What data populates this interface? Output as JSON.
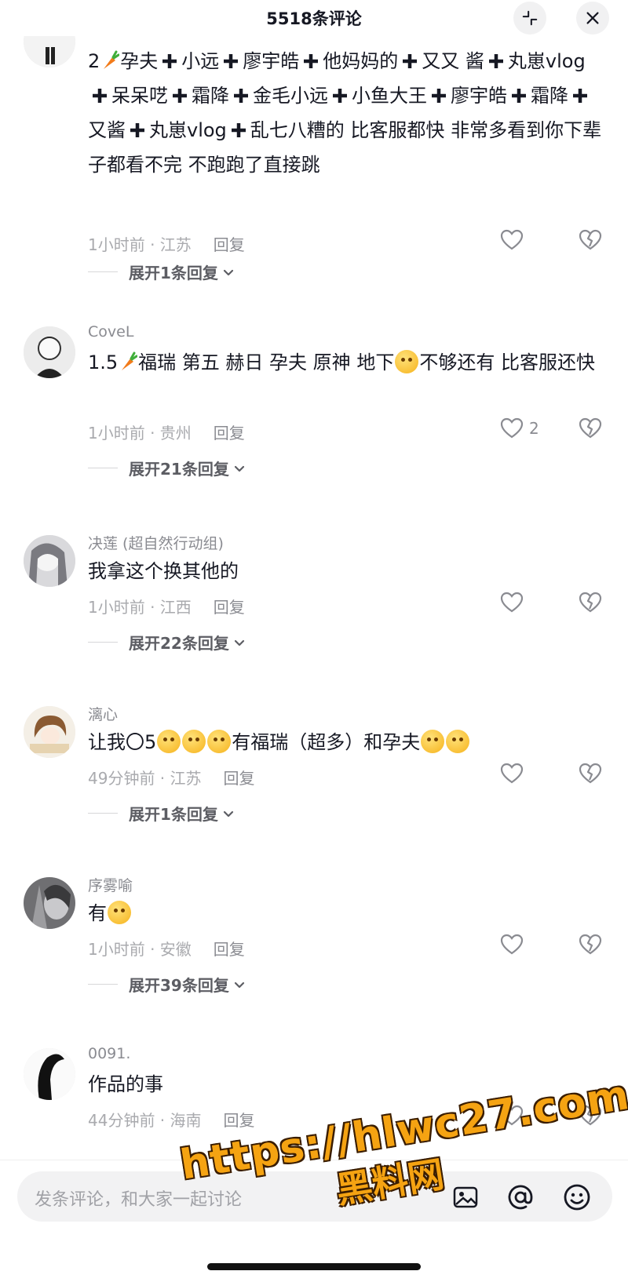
{
  "header": {
    "title": "5518条评论"
  },
  "comments": [
    {
      "username": "",
      "segments": [
        "2",
        "孕夫",
        "小远",
        "廖宇皓",
        "他妈妈的",
        "又又 酱",
        "丸崽vlog",
        "呆呆呓",
        "霜降",
        "金毛小远",
        "小鱼大王",
        "廖宇皓",
        "霜降",
        "又酱",
        "丸崽vlog",
        "乱七八糟的"
      ],
      "tail": "比客服都快 非常多看到你下辈子都看不完 不跑跑了直接跳",
      "time": "1小时前 · 江苏",
      "reply": "回复",
      "likes": "",
      "expand": "展开1条回复"
    },
    {
      "username": "CoveL",
      "text_a": "1.5",
      "text_b": "福瑞 第五 赫日 孕夫 原神 地下",
      "text_c": "不够还有 比客服还快",
      "time": "1小时前 · 贵州",
      "reply": "回复",
      "likes": "2",
      "expand": "展开21条回复"
    },
    {
      "username": "决莲 (超自然行动组)",
      "text": "我拿这个换其他的",
      "time": "1小时前 · 江西",
      "reply": "回复",
      "likes": "",
      "expand": "展开22条回复"
    },
    {
      "username": "漓心",
      "text_a": "让我〇5",
      "text_b": "有福瑞（超多）和孕夫",
      "time": "49分钟前 · 江苏",
      "reply": "回复",
      "likes": "",
      "expand": "展开1条回复"
    },
    {
      "username": "序雾喻",
      "text": "有",
      "time": "1小时前 · 安徽",
      "reply": "回复",
      "likes": "",
      "expand": "展开39条回复"
    },
    {
      "username": "0091.",
      "text": "作品的事",
      "time": "44分钟前 · 海南",
      "reply": "回复",
      "likes": ""
    }
  ],
  "input": {
    "placeholder": "发条评论，和大家一起讨论"
  },
  "watermark": {
    "url": "https://hlwc27.com",
    "name": "黑料网"
  },
  "colors": {
    "text": "#161823",
    "muted": "#a9aaae",
    "watermark": "#f5a312"
  }
}
